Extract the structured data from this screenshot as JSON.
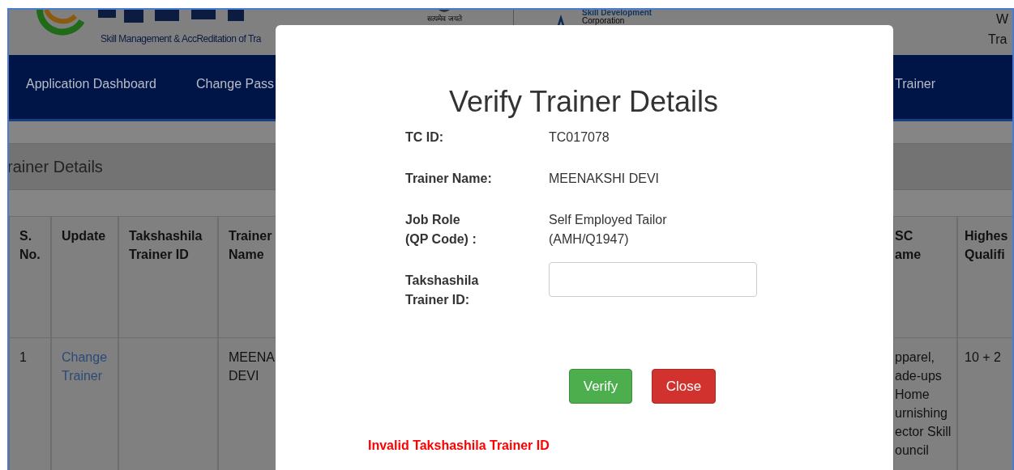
{
  "header": {
    "logo_tagline": "Skill Management & AccReditation of Tra",
    "emblem_caption": "सत्यमेव जयते",
    "partner_line_1": "Skill Development",
    "partner_line_2": "Corporation",
    "right_line_1": "W",
    "right_line_2": "Tra"
  },
  "nav": [
    {
      "label": "Application Dashboard"
    },
    {
      "label": "Change Pass"
    },
    {
      "label": "Trainer"
    }
  ],
  "panel": {
    "title": "rainer Details"
  },
  "table": {
    "columns": [
      {
        "lines": [
          "S.",
          "No."
        ]
      },
      {
        "lines": [
          "Update"
        ]
      },
      {
        "lines": [
          "Takshashila",
          "Trainer ID"
        ]
      },
      {
        "lines": [
          "Trainer",
          "Name"
        ]
      },
      {
        "lines": [
          "SC",
          "ame"
        ]
      },
      {
        "lines": [
          "Highes",
          "Qualifi"
        ]
      }
    ],
    "rows": [
      {
        "cells": [
          {
            "lines": [
              "1"
            ],
            "kind": "text"
          },
          {
            "lines": [
              "Change",
              "Trainer"
            ],
            "kind": "link"
          },
          {
            "kind": "empty"
          },
          {
            "lines": [
              "MEENA",
              "DEVI"
            ],
            "kind": "text"
          },
          {
            "lines": [
              "pparel,",
              "ade-ups",
              "Home",
              "urnishing",
              "ector Skill",
              "ouncil"
            ],
            "kind": "text"
          },
          {
            "lines": [
              "10 + 2"
            ],
            "kind": "text"
          }
        ]
      }
    ]
  },
  "modal": {
    "title": "Verify Trainer Details",
    "fields": [
      {
        "label": "TC ID:",
        "value": "TC017078",
        "kind": "text"
      },
      {
        "label": "Trainer Name:",
        "value": "MEENAKSHI DEVI",
        "kind": "text"
      },
      {
        "label": "Job Role\n(QP Code) :",
        "value": "Self Employed Tailor\n(AMH/Q1947)",
        "kind": "text"
      },
      {
        "label": "Takshashila\nTrainer ID:",
        "kind": "input"
      }
    ],
    "buttons": [
      {
        "label": "Verify",
        "kind": "success"
      },
      {
        "label": "Close",
        "kind": "danger"
      }
    ],
    "error": "Invalid Takshashila Trainer ID"
  }
}
